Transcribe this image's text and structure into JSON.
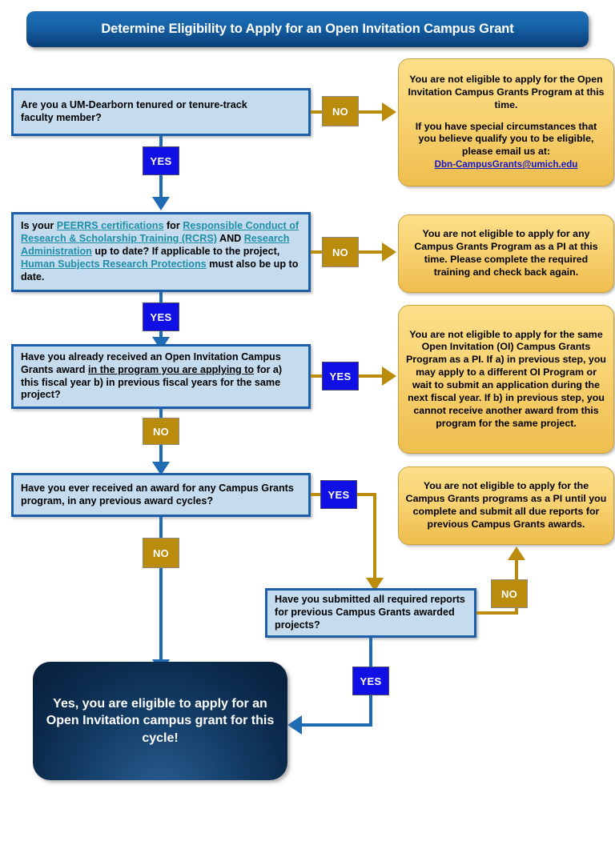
{
  "title": {
    "text": "Determine Eligibility to Apply for an Open Invitation Campus Grant"
  },
  "questions": {
    "q1": {
      "line1": "Are you a UM-Dearborn tenured or tenure-track",
      "line2": "faculty member?"
    },
    "q2": {
      "pre1": "Is your ",
      "link1": "PEERRS certifications",
      "mid1": " for ",
      "link2": "Responsible Conduct of Research & Scholarship Training (RCRS)",
      "mid2": " AND ",
      "link3": "Research Administration",
      "mid3": " up to date? If applicable to the project, ",
      "link4": "Human Subjects Research Protections",
      "post": " must also be up to date."
    },
    "q3": {
      "pre": "Have you already received an Open Invitation Campus Grants award ",
      "emph": "in the program you are applying to",
      "post": " for a) this fiscal year b) in previous fiscal years for the same project?"
    },
    "q4": {
      "text": "Have you ever received an award for any Campus Grants program, in any previous award cycles?"
    },
    "q5": {
      "text": "Have you submitted all required reports for previous Campus Grants awarded projects?"
    }
  },
  "outcomes": {
    "o1": {
      "para1": "You are not eligible to apply for the Open Invitation Campus Grants Program at this time.",
      "para2": "If you have special circumstances that you believe qualify you to be eligible, please email us at:",
      "email": "Dbn-CampusGrants@umich.edu"
    },
    "o2": {
      "text": "You are not eligible to apply for any Campus Grants Program as a PI at this time. Please complete the required training and check back again."
    },
    "o3": {
      "text": "You are not eligible to apply for the same Open Invitation (OI) Campus Grants Program as a PI. If a) in previous step, you may apply to a different OI Program or wait to submit an application during the next fiscal year. If b) in previous step, you cannot receive another award from this program for the same project."
    },
    "o4": {
      "text": "You are not eligible to apply for the Campus Grants programs as a PI until you complete and submit all due reports for previous Campus Grants awards."
    }
  },
  "final": {
    "text": "Yes, you are eligible to apply for an Open Invitation campus grant for this cycle!"
  },
  "badges": {
    "q1_no": "NO",
    "q1_yes": "YES",
    "q2_no": "NO",
    "q2_yes": "YES",
    "q3_yes": "YES",
    "q3_no": "NO",
    "q4_yes": "YES",
    "q4_no": "NO",
    "q5_no": "NO",
    "q5_yes": "YES"
  },
  "colors": {
    "banner_blue": "#1763a8",
    "question_fill": "#c5dcef",
    "question_border": "#1f5fa9",
    "outcome_fill": "#f8d272",
    "outcome_border": "#c9a23c",
    "yes_badge": "#0f0fe6",
    "no_badge": "#bb8b0c",
    "connector_blue": "#1f6cb4",
    "connector_gold": "#bb8b0c",
    "hyperlink_teal": "#1f8fa8",
    "email_link_blue": "#1414d0",
    "final_box_navy": "#0c2b4d"
  }
}
